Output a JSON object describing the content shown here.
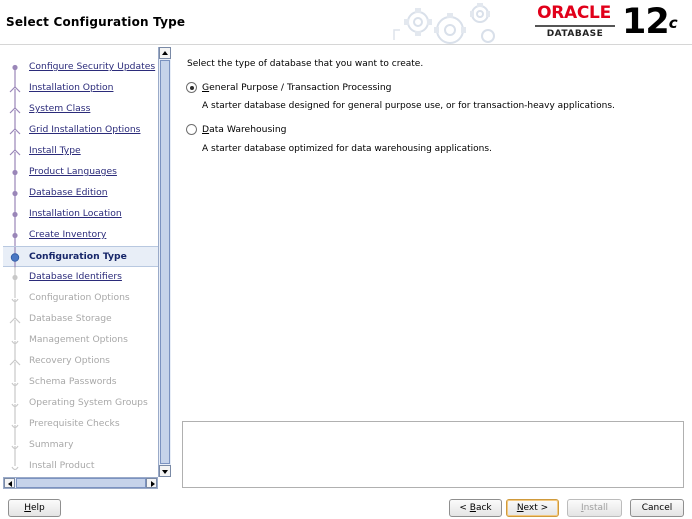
{
  "header": {
    "title": "Select Configuration Type",
    "brand": {
      "name": "ORACLE",
      "product": "DATABASE",
      "version": "12",
      "version_suffix": "c"
    }
  },
  "nav": {
    "steps": [
      {
        "label": "Configure Security Updates",
        "state": "done"
      },
      {
        "label": "Installation Option",
        "state": "done"
      },
      {
        "label": "System Class",
        "state": "done"
      },
      {
        "label": "Grid Installation Options",
        "state": "done"
      },
      {
        "label": "Install Type",
        "state": "done"
      },
      {
        "label": "Product Languages",
        "state": "done"
      },
      {
        "label": "Database Edition",
        "state": "done"
      },
      {
        "label": "Installation Location",
        "state": "done"
      },
      {
        "label": "Create Inventory",
        "state": "done"
      },
      {
        "label": "Configuration Type",
        "state": "current"
      },
      {
        "label": "Database Identifiers",
        "state": "next"
      },
      {
        "label": "Configuration Options",
        "state": "future"
      },
      {
        "label": "Database Storage",
        "state": "future"
      },
      {
        "label": "Management Options",
        "state": "future"
      },
      {
        "label": "Recovery Options",
        "state": "future"
      },
      {
        "label": "Schema Passwords",
        "state": "future"
      },
      {
        "label": "Operating System Groups",
        "state": "future"
      },
      {
        "label": "Prerequisite Checks",
        "state": "future"
      },
      {
        "label": "Summary",
        "state": "future"
      },
      {
        "label": "Install Product",
        "state": "future"
      }
    ]
  },
  "main": {
    "prompt": "Select the type of database that you want to create.",
    "options": [
      {
        "mnemonic": "G",
        "label_rest": "eneral Purpose / Transaction Processing",
        "description": "A starter database designed for general purpose use, or for transaction-heavy applications.",
        "selected": true
      },
      {
        "mnemonic": "D",
        "label_rest": "ata Warehousing",
        "description": "A starter database optimized for data warehousing applications.",
        "selected": false
      }
    ]
  },
  "buttons": {
    "help": {
      "mnemonic": "H",
      "rest": "elp"
    },
    "back": {
      "prefix": "< ",
      "mnemonic": "B",
      "rest": "ack"
    },
    "next": {
      "mnemonic": "N",
      "rest": "ext >"
    },
    "install": {
      "mnemonic": "I",
      "rest": "nstall"
    },
    "cancel": {
      "label": "Cancel"
    }
  }
}
